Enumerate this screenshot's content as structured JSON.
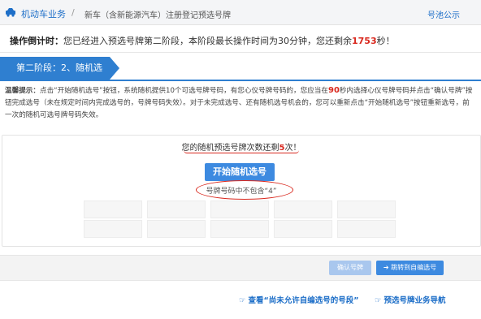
{
  "header": {
    "business": "机动车业务",
    "separator": "/",
    "breadcrumb": "新车（含新能源汽车）注册登记预选号牌",
    "notice_link": "号池公示"
  },
  "countdown": {
    "label": "操作倒计时：",
    "text_before": "您已经进入预选号牌第二阶段，本阶段最长操作时间为30分钟，您还剩余",
    "seconds": "1753",
    "text_after": "秒！"
  },
  "stage": {
    "title": "第二阶段：2、随机选号"
  },
  "tips": {
    "label": "温馨提示：",
    "part1": "点击“开始随机选号”按钮，系统随机提供10个可选号牌号码，有您心仪号牌号码的，您应当在",
    "seconds": "90",
    "part2": "秒内选择心仪号牌号码并点击“确认号牌”按钮完成选号（未在规定时间内完成选号的，号牌号码失效）。对于未完成选号、还有随机选号机会的，您可以重新点击“开始随机选号”按钮重新选号，前一次的随机可选号牌号码失效。"
  },
  "random": {
    "remain_prefix": "您的随机预选号牌次数还剩",
    "remain_count": "5",
    "remain_suffix": "次！",
    "start_button": "开始随机选号",
    "exclude_note": "号牌号码中不包含“4”"
  },
  "actions": {
    "confirm": "确认号牌",
    "jump": "跳转到自编选号"
  },
  "links": {
    "view_disallowed": "查看“尚未允许自编选号的号段”",
    "guide": "预选号牌业务导航"
  },
  "colors": {
    "accent": "#2f7fd0",
    "alert": "#d9281e"
  }
}
